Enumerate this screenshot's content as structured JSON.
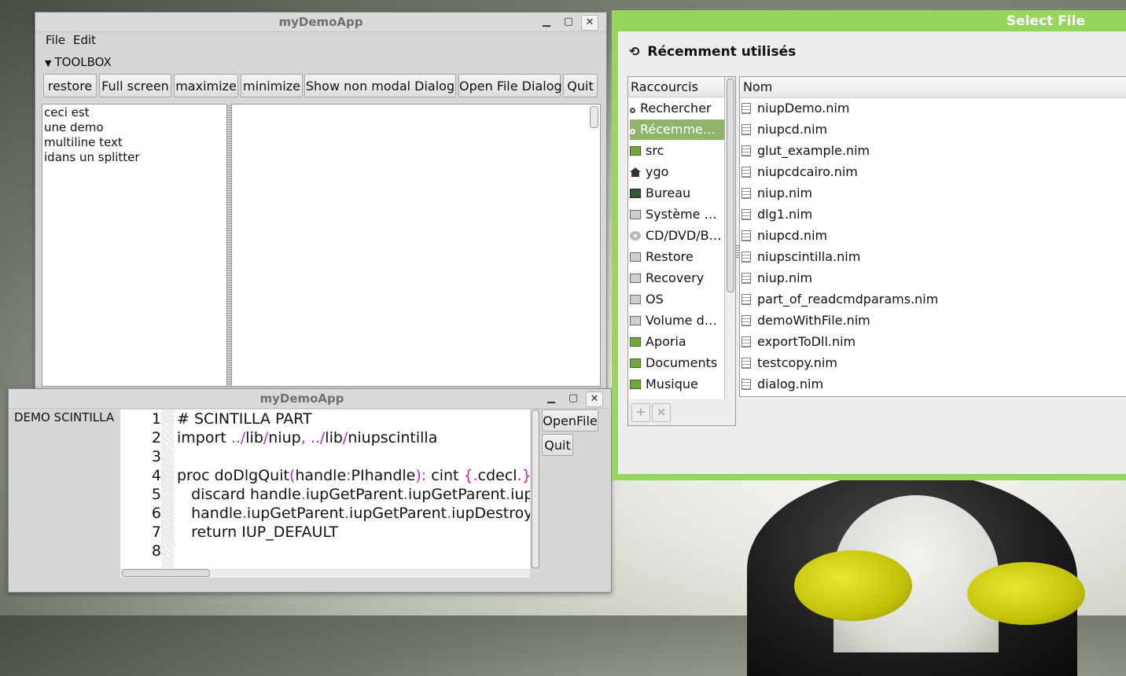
{
  "main_window": {
    "title": "myDemoApp",
    "menu": [
      "File",
      "Edit"
    ],
    "toolbox_label": "TOOLBOX",
    "buttons": [
      "restore",
      "Full screen",
      "maximize",
      "minimize",
      "Show non modal Dialog",
      "Open File Dialog",
      "Quit"
    ],
    "text_lines": [
      "ceci est",
      "une demo",
      "multiline text",
      "idans un splitter"
    ]
  },
  "scintilla_window": {
    "title": "myDemoApp",
    "label": "DEMO SCINTILLA",
    "line_numbers": [
      "1",
      "2",
      "3",
      "4",
      "5",
      "6",
      "7",
      "8"
    ],
    "buttons": [
      "OpenFile",
      "Quit"
    ]
  },
  "select_file": {
    "title": "Select File",
    "location": "Récemment utilisés",
    "shortcuts_header": "Raccourcis",
    "name_header": "Nom",
    "shortcuts": [
      {
        "label": "Rechercher",
        "icon": "search-icon"
      },
      {
        "label": "Récemme…",
        "icon": "recent-icon"
      },
      {
        "label": "src",
        "icon": "folder-icon"
      },
      {
        "label": "ygo",
        "icon": "home-icon"
      },
      {
        "label": "Bureau",
        "icon": "desktop-icon"
      },
      {
        "label": "Système …",
        "icon": "drive-icon"
      },
      {
        "label": "CD/DVD/B…",
        "icon": "disc-icon"
      },
      {
        "label": "Restore",
        "icon": "drive-icon"
      },
      {
        "label": "Recovery",
        "icon": "drive-icon"
      },
      {
        "label": "OS",
        "icon": "drive-icon"
      },
      {
        "label": "Volume d…",
        "icon": "drive-icon"
      },
      {
        "label": "Aporia",
        "icon": "folder-icon"
      },
      {
        "label": "Documents",
        "icon": "documents-icon"
      },
      {
        "label": "Musique",
        "icon": "music-icon"
      }
    ],
    "files": [
      "niupDemo.nim",
      "niupcd.nim",
      "glut_example.nim",
      "niupcdcairo.nim",
      "niup.nim",
      "dlg1.nim",
      "niupcd.nim",
      "niupscintilla.nim",
      "niup.nim",
      "part_of_readcmdparams.nim",
      "demoWithFile.nim",
      "exportToDll.nim",
      "testcopy.nim",
      "dialog.nim"
    ],
    "add_label": "+",
    "remove_label": "×"
  },
  "colors": {
    "accent_green": "#97d65e",
    "selection": "#8fb56a",
    "keyword_magenta": "#d01ad0"
  }
}
